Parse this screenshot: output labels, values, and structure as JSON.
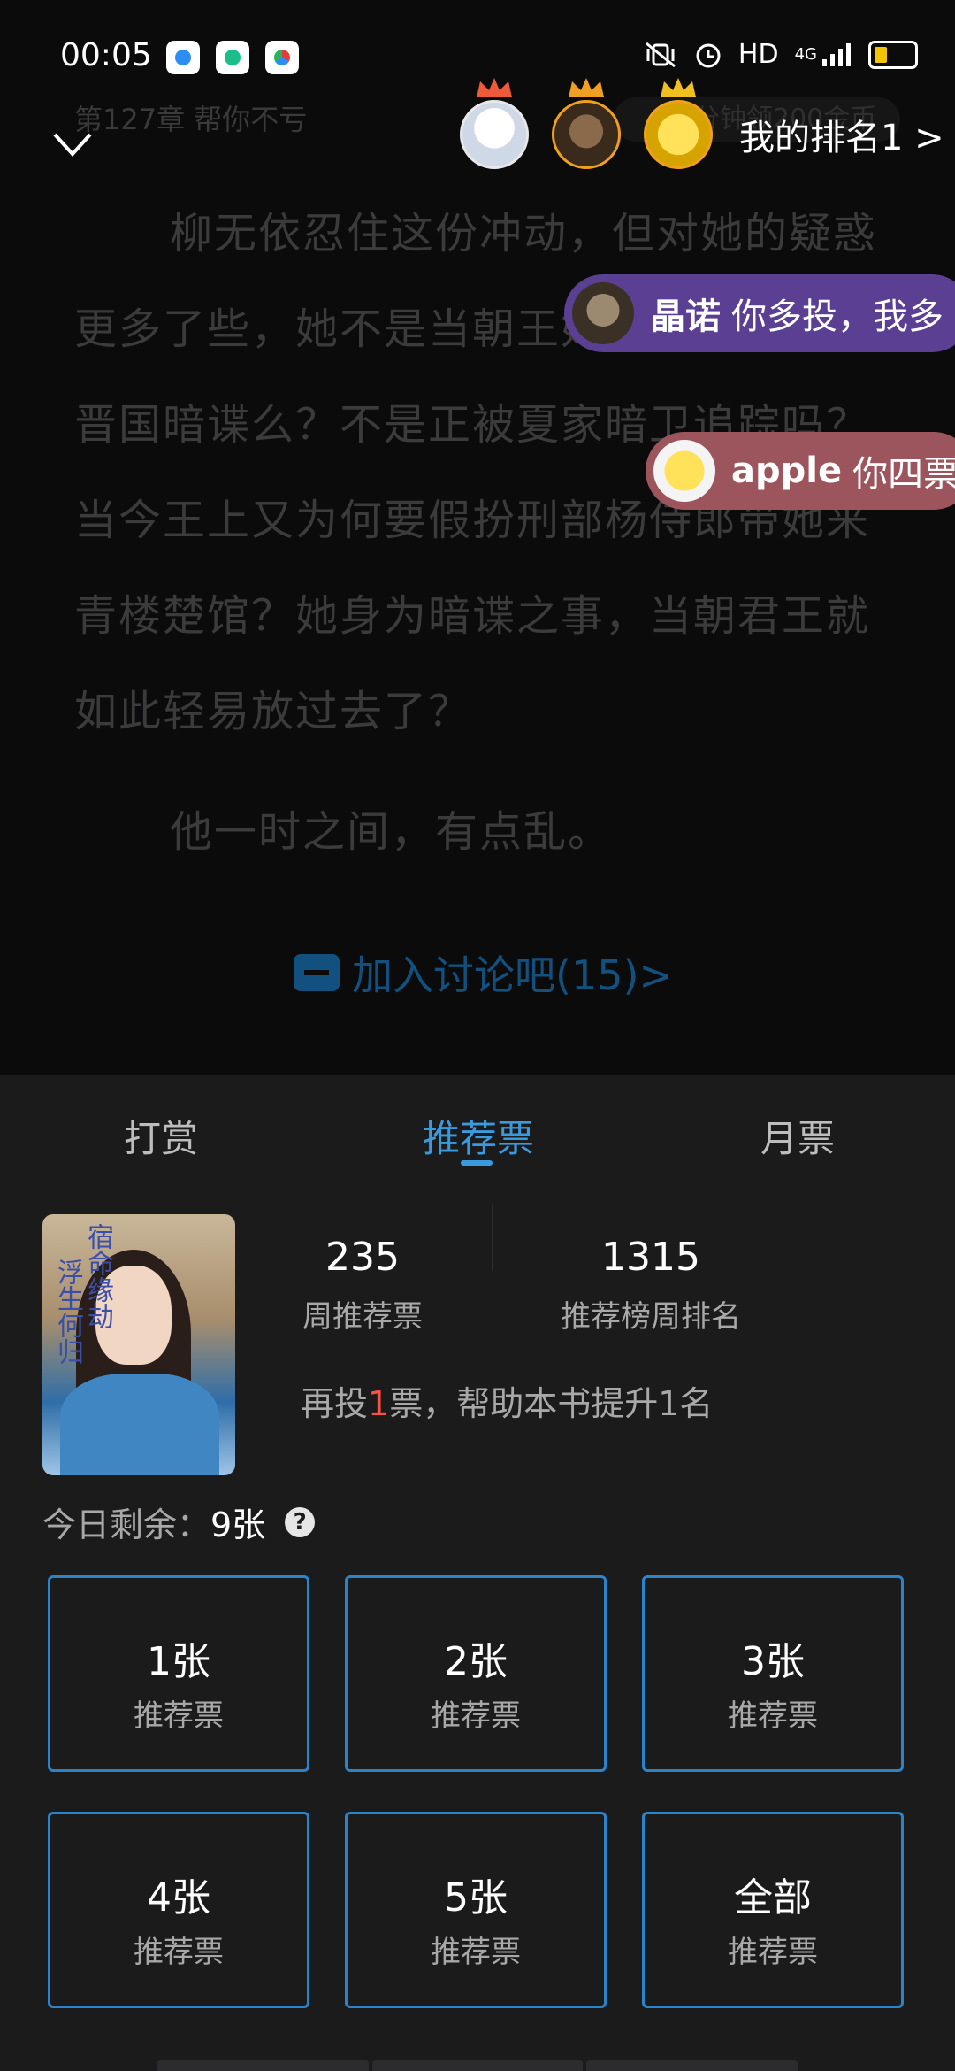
{
  "status_bar": {
    "time": "00:05",
    "network": "HD",
    "network_type": "4G"
  },
  "reader": {
    "chapter_title": "第127章 帮你不亏",
    "my_rank": "我的排名1 >",
    "ad_text": "分钟领200金币",
    "paragraph1": "柳无依忍住这份冲动，但对她的疑惑更多了些，她不是当朝王妃吗？何样也是晋国暗谍么？不是正被夏家暗卫追踪吗？当今王上又为何要假扮刑部杨侍郎带她来青楼楚馆？她身为暗谍之事，当朝君王就如此轻易放过去了？",
    "paragraph2": "他一时之间，有点乱。",
    "discussion": "加入讨论吧(15)>",
    "danmaku": [
      {
        "name": "晶诺",
        "text": "你多投，我多"
      },
      {
        "name": "apple",
        "text": "你四票"
      }
    ]
  },
  "sheet": {
    "tabs": [
      "打赏",
      "推荐票",
      "月票"
    ],
    "active_tab": "推荐票",
    "cover_text_1": "宿命缘劫",
    "cover_text_2": "浮生何归",
    "stats": [
      {
        "value": "235",
        "label": "周推荐票"
      },
      {
        "value": "1315",
        "label": "推荐榜周排名"
      }
    ],
    "hint_prefix": "再投",
    "hint_highlight": "1",
    "hint_suffix": "票，帮助本书提升1名",
    "remaining_label": "今日剩余：",
    "remaining_value": "9张",
    "help_icon": "?",
    "options": [
      {
        "qty": "1张",
        "type": "推荐票"
      },
      {
        "qty": "2张",
        "type": "推荐票"
      },
      {
        "qty": "3张",
        "type": "推荐票"
      },
      {
        "qty": "4张",
        "type": "推荐票"
      },
      {
        "qty": "5张",
        "type": "推荐票"
      },
      {
        "qty": "全部",
        "type": "推荐票"
      }
    ]
  },
  "colors": {
    "accent": "#3a9ae0",
    "highlight": "#ff5046",
    "sheet_bg": "#1b1b1c"
  }
}
